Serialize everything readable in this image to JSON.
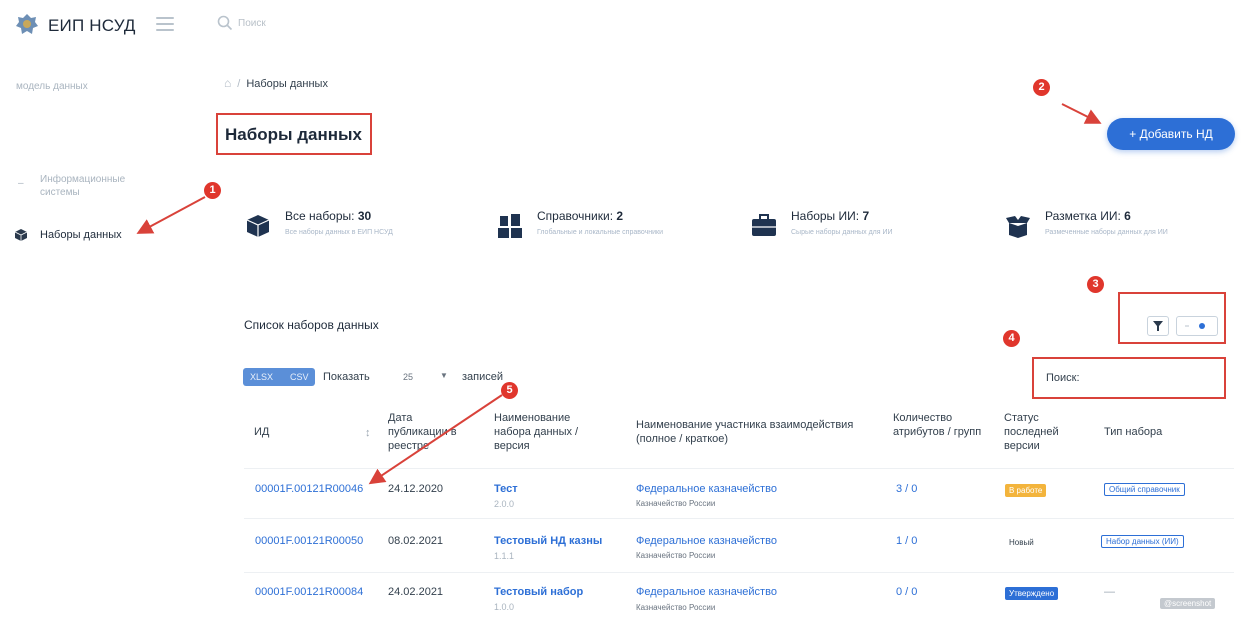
{
  "app": {
    "title": "ЕИП НСУД"
  },
  "search": {
    "placeholder": "Поиск"
  },
  "sidebar": {
    "heading": "модель данных",
    "items": [
      {
        "label": "Информационные системы",
        "active": false
      },
      {
        "label": "Наборы данных",
        "active": true
      }
    ]
  },
  "breadcrumb": {
    "separator": "/",
    "current": "Наборы данных"
  },
  "page": {
    "title": "Наборы данных",
    "add_button": "+ Добавить НД"
  },
  "stats": [
    {
      "label": "Все наборы:",
      "count": "30",
      "desc": "Все наборы данных в ЕИП НСУД",
      "icon": "box-icon"
    },
    {
      "label": "Справочники:",
      "count": "2",
      "desc": "Глобальные и локальные справочники",
      "icon": "blocks-icon"
    },
    {
      "label": "Наборы ИИ:",
      "count": "7",
      "desc": "Сырые наборы данных для ИИ",
      "icon": "case-icon"
    },
    {
      "label": "Разметка ИИ:",
      "count": "6",
      "desc": "Размеченные наборы данных для ИИ",
      "icon": "open-box-icon"
    }
  ],
  "list": {
    "title": "Список наборов данных",
    "export": {
      "xlsx": "XLSX",
      "csv": "CSV"
    },
    "show_label": "Показать",
    "page_size": "25",
    "show_suffix": "записей",
    "search_label": "Поиск:"
  },
  "table": {
    "columns": {
      "id": "ИД",
      "date": "Дата публикации в реестре",
      "name": "Наименование набора данных / версия",
      "org": "Наименование участника взаимодействия (полное / краткое)",
      "attrs": "Количество атрибутов / групп",
      "status": "Статус последней версии",
      "type": "Тип набора"
    },
    "rows": [
      {
        "id": "00001F.00121R00046",
        "date": "24.12.2020",
        "name": "Тест",
        "version": "2.0.0",
        "org": "Федеральное казначейство",
        "org_short": "Казначейство России",
        "attrs": "3 / 0",
        "status": "В работе",
        "type": "Общий справочник"
      },
      {
        "id": "00001F.00121R00050",
        "date": "08.02.2021",
        "name": "Тестовый НД казны",
        "version": "1.1.1",
        "org": "Федеральное казначейство",
        "org_short": "Казначейство России",
        "attrs": "1 / 0",
        "status": "Новый",
        "type": "Набор данных (ИИ)"
      },
      {
        "id": "00001F.00121R00084",
        "date": "24.02.2021",
        "name": "Тестовый набор",
        "version": "1.0.0",
        "org": "Федеральное казначейство",
        "org_short": "Казначейство России",
        "attrs": "0 / 0",
        "status": "Утверждено",
        "type": "—"
      }
    ]
  },
  "markers": [
    "1",
    "2",
    "3",
    "4",
    "5"
  ],
  "watermark": "@screenshot",
  "colors": {
    "accent": "#2d6fd6",
    "annotation": "#d9423a",
    "status_work": "#f3b43c",
    "status_approved": "#2d6fd6"
  }
}
